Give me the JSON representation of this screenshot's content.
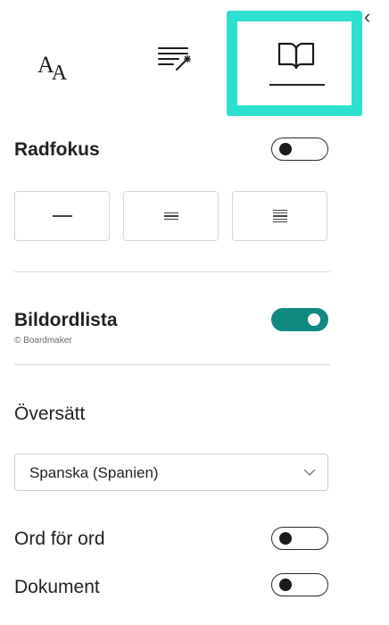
{
  "tabs": [
    {
      "name": "text-preferences",
      "icon": "text-size-icon",
      "glyph_big": "A",
      "glyph_small": "A"
    },
    {
      "name": "grammar-options",
      "icon": "grammar-wand-icon"
    },
    {
      "name": "reading-preferences",
      "icon": "open-book-icon",
      "selected": true
    }
  ],
  "line_focus": {
    "label": "Radfokus",
    "enabled": false,
    "options": [
      {
        "name": "one-line",
        "lines": 1
      },
      {
        "name": "three-lines",
        "lines": 3
      },
      {
        "name": "five-lines",
        "lines": 5
      }
    ]
  },
  "picture_dictionary": {
    "label": "Bildordlista",
    "attribution": "© Boardmaker",
    "enabled": true
  },
  "translate": {
    "label": "Översätt",
    "language": "Spanska (Spanien)",
    "word_by_word_label": "Ord för ord",
    "word_by_word_enabled": false,
    "document_label": "Dokument",
    "document_enabled": false
  },
  "colors": {
    "highlight": "#2ee0cf",
    "toggle_on": "#0f8a80"
  }
}
